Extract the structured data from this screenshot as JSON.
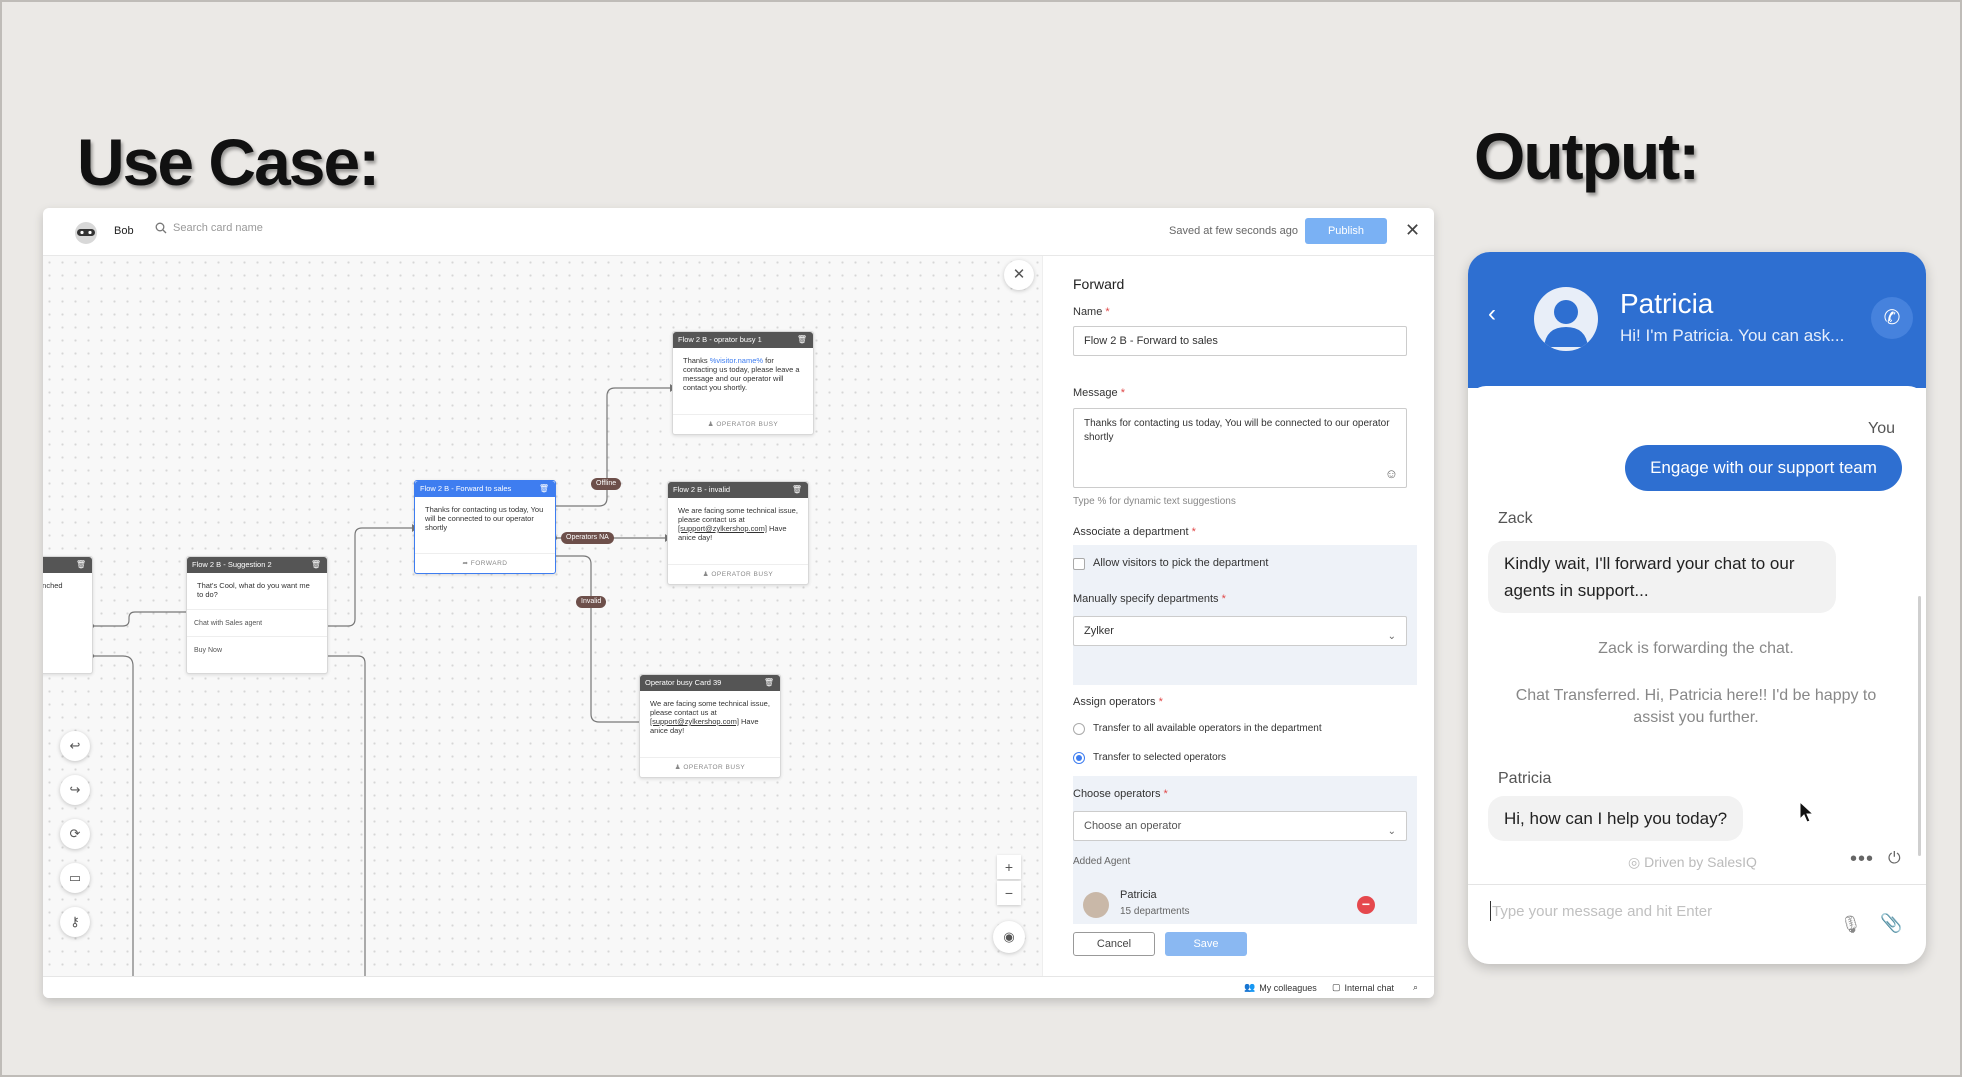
{
  "headings": {
    "use_case": "Use Case:",
    "output": "Output:"
  },
  "builder": {
    "bot_name": "Bob",
    "search_placeholder": "Search card name",
    "saved_status": "Saved at few seconds ago",
    "publish_label": "Publish",
    "cards": {
      "left_partial": {
        "text": "unched"
      },
      "suggestion": {
        "title": "Flow 2 B - Suggestion 2",
        "text": "That's Cool, what do you want me to do?",
        "option1": "Chat with Sales agent",
        "option2": "Buy Now"
      },
      "forward": {
        "title": "Flow 2 B - Forward to sales",
        "text": "Thanks for contacting us today, You will be connected to our operator shortly",
        "footer": "FORWARD"
      },
      "busy1": {
        "title": "Flow 2 B - oprator busy 1",
        "text_before": "Thanks ",
        "text_link": "%visitor.name%",
        "text_after": " for contacting us today, please leave a message and our operator will contact you shortly.",
        "footer": "OPERATOR BUSY"
      },
      "invalid": {
        "title": "Flow 2 B - invalid",
        "text_before": "We are facing some technical issue, please contact us at ",
        "email": "[support@zylkershop.com]",
        "text_after": " Have anice day!",
        "footer": "OPERATOR BUSY"
      },
      "busy39": {
        "title": "Operator busy Card 39",
        "text_before": "We are facing some technical issue, please contact us at ",
        "email": "[support@zylkershop.com]",
        "text_after": " Have anice day!",
        "footer": "OPERATOR BUSY"
      }
    },
    "edge_labels": {
      "offline": "Offline",
      "operators_na": "Operators NA",
      "invalid": "Invalid"
    },
    "panel": {
      "title": "Forward",
      "name_label": "Name",
      "name_value": "Flow 2 B - Forward to sales",
      "message_label": "Message",
      "message_value": "Thanks for contacting us today, You will be connected to our operator shortly",
      "hint": "Type % for dynamic text suggestions",
      "dept_label": "Associate a department",
      "allow_visitors": "Allow visitors to pick the department",
      "manual_label": "Manually specify departments",
      "dept_value": "Zylker",
      "assign_label": "Assign operators",
      "option_all": "Transfer to all available operators in the department",
      "option_selected": "Transfer to selected operators",
      "choose_label": "Choose operators",
      "choose_placeholder": "Choose an operator",
      "added_label": "Added Agent",
      "agent_name": "Patricia",
      "agent_depts": "15 departments",
      "cancel_label": "Cancel",
      "save_label": "Save"
    },
    "status": {
      "colleagues": "My colleagues",
      "internal_chat": "Internal chat"
    }
  },
  "chat": {
    "agent_name": "Patricia",
    "agent_status": "Hi! I'm Patricia. You can ask...",
    "you_label": "You",
    "user_message": "Engage with our support team",
    "bot_name": "Zack",
    "bot_message": "Kindly wait, I'll forward your chat to our agents in support...",
    "forwarding": "Zack is forwarding the chat.",
    "transferred": "Chat Transferred. Hi, Patricia here!! I'd be happy to assist you further.",
    "agent_label": "Patricia",
    "agent_message": "Hi, how can I help you today?",
    "powered_by": "Driven by SalesIQ",
    "input_placeholder": "Type your message and hit Enter"
  },
  "colors": {
    "brand_blue": "#2e6fd1",
    "selected_card": "#3e7df0",
    "publish": "#7ab1f4",
    "remove": "#e5484d"
  }
}
